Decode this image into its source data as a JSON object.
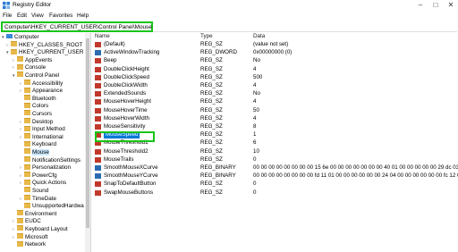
{
  "window": {
    "title": "Registry Editor"
  },
  "menu": [
    "File",
    "Edit",
    "View",
    "Favorites",
    "Help"
  ],
  "address": {
    "path": "Computer\\HKEY_CURRENT_USER\\Control Panel\\Mouse"
  },
  "tree": [
    {
      "label": "Computer",
      "exp": "▾",
      "level": 0,
      "icon": "pc"
    },
    {
      "label": "HKEY_CLASSES_ROOT",
      "exp": "›",
      "level": 1,
      "icon": "folder"
    },
    {
      "label": "HKEY_CURRENT_USER",
      "exp": "▾",
      "level": 1,
      "icon": "folder"
    },
    {
      "label": "AppEvents",
      "exp": "›",
      "level": 2,
      "icon": "folder"
    },
    {
      "label": "Console",
      "exp": "›",
      "level": 2,
      "icon": "folder"
    },
    {
      "label": "Control Panel",
      "exp": "▾",
      "level": 2,
      "icon": "folder"
    },
    {
      "label": "Accessibility",
      "exp": "›",
      "level": 3,
      "icon": "folder"
    },
    {
      "label": "Appearance",
      "exp": "›",
      "level": 3,
      "icon": "folder"
    },
    {
      "label": "Bluetooth",
      "exp": "",
      "level": 3,
      "icon": "folder"
    },
    {
      "label": "Colors",
      "exp": "",
      "level": 3,
      "icon": "folder"
    },
    {
      "label": "Cursors",
      "exp": "",
      "level": 3,
      "icon": "folder"
    },
    {
      "label": "Desktop",
      "exp": "›",
      "level": 3,
      "icon": "folder"
    },
    {
      "label": "Input Method",
      "exp": "›",
      "level": 3,
      "icon": "folder"
    },
    {
      "label": "International",
      "exp": "›",
      "level": 3,
      "icon": "folder"
    },
    {
      "label": "Keyboard",
      "exp": "",
      "level": 3,
      "icon": "folder"
    },
    {
      "label": "Mouse",
      "exp": "",
      "level": 3,
      "icon": "folder",
      "selected": true
    },
    {
      "label": "NotificationSettings",
      "exp": "",
      "level": 3,
      "icon": "folder"
    },
    {
      "label": "Personalization",
      "exp": "›",
      "level": 3,
      "icon": "folder"
    },
    {
      "label": "PowerCfg",
      "exp": "›",
      "level": 3,
      "icon": "folder"
    },
    {
      "label": "Quick Actions",
      "exp": "›",
      "level": 3,
      "icon": "folder"
    },
    {
      "label": "Sound",
      "exp": "",
      "level": 3,
      "icon": "folder"
    },
    {
      "label": "TimeDate",
      "exp": "›",
      "level": 3,
      "icon": "folder"
    },
    {
      "label": "UnsupportedHardwa",
      "exp": "",
      "level": 3,
      "icon": "folder"
    },
    {
      "label": "Environment",
      "exp": "",
      "level": 2,
      "icon": "folder"
    },
    {
      "label": "EUDC",
      "exp": "›",
      "level": 2,
      "icon": "folder"
    },
    {
      "label": "Keyboard Layout",
      "exp": "›",
      "level": 2,
      "icon": "folder"
    },
    {
      "label": "Microsoft",
      "exp": "›",
      "level": 2,
      "icon": "folder"
    },
    {
      "label": "Network",
      "exp": "",
      "level": 2,
      "icon": "folder"
    }
  ],
  "columns": {
    "name": "Name",
    "type": "Type",
    "data": "Data"
  },
  "values": [
    {
      "name": "(Default)",
      "type": "REG_SZ",
      "data": "(value not set)",
      "icon": "ab"
    },
    {
      "name": "ActiveWindowTracking",
      "type": "REG_DWORD",
      "data": "0x00000000 (0)",
      "icon": "bin"
    },
    {
      "name": "Beep",
      "type": "REG_SZ",
      "data": "No",
      "icon": "ab"
    },
    {
      "name": "DoubleClickHeight",
      "type": "REG_SZ",
      "data": "4",
      "icon": "ab"
    },
    {
      "name": "DoubleClickSpeed",
      "type": "REG_SZ",
      "data": "500",
      "icon": "ab"
    },
    {
      "name": "DoubleClickWidth",
      "type": "REG_SZ",
      "data": "4",
      "icon": "ab"
    },
    {
      "name": "ExtendedSounds",
      "type": "REG_SZ",
      "data": "No",
      "icon": "ab"
    },
    {
      "name": "MouseHoverHeight",
      "type": "REG_SZ",
      "data": "4",
      "icon": "ab"
    },
    {
      "name": "MouseHoverTime",
      "type": "REG_SZ",
      "data": "50",
      "icon": "ab"
    },
    {
      "name": "MouseHoverWidth",
      "type": "REG_SZ",
      "data": "4",
      "icon": "ab"
    },
    {
      "name": "MouseSensitivity",
      "type": "REG_SZ",
      "data": "8",
      "icon": "ab"
    },
    {
      "name": "MouseSpeed",
      "type": "REG_SZ",
      "data": "1",
      "icon": "ab",
      "selected": true
    },
    {
      "name": "MouseThreshold1",
      "type": "REG_SZ",
      "data": "6",
      "icon": "ab"
    },
    {
      "name": "MouseThreshold2",
      "type": "REG_SZ",
      "data": "10",
      "icon": "ab"
    },
    {
      "name": "MouseTrails",
      "type": "REG_SZ",
      "data": "0",
      "icon": "ab"
    },
    {
      "name": "SmoothMouseXCurve",
      "type": "REG_BINARY",
      "data": "00 00 00 00 00 00 00 00 15 6e 00 00 00 00 00 00 00 40 01 00 00 00 00 00 29 dc 03 00 00 ...",
      "icon": "bin"
    },
    {
      "name": "SmoothMouseYCurve",
      "type": "REG_BINARY",
      "data": "00 00 00 00 00 00 00 00 fd 11 01 00 00 00 00 00 00 24 04 00 00 00 00 00 00 fc 12 00 00 ...",
      "icon": "bin"
    },
    {
      "name": "SnapToDefaultButton",
      "type": "REG_SZ",
      "data": "0",
      "icon": "ab"
    },
    {
      "name": "SwapMouseButtons",
      "type": "REG_SZ",
      "data": "0",
      "icon": "ab"
    }
  ]
}
